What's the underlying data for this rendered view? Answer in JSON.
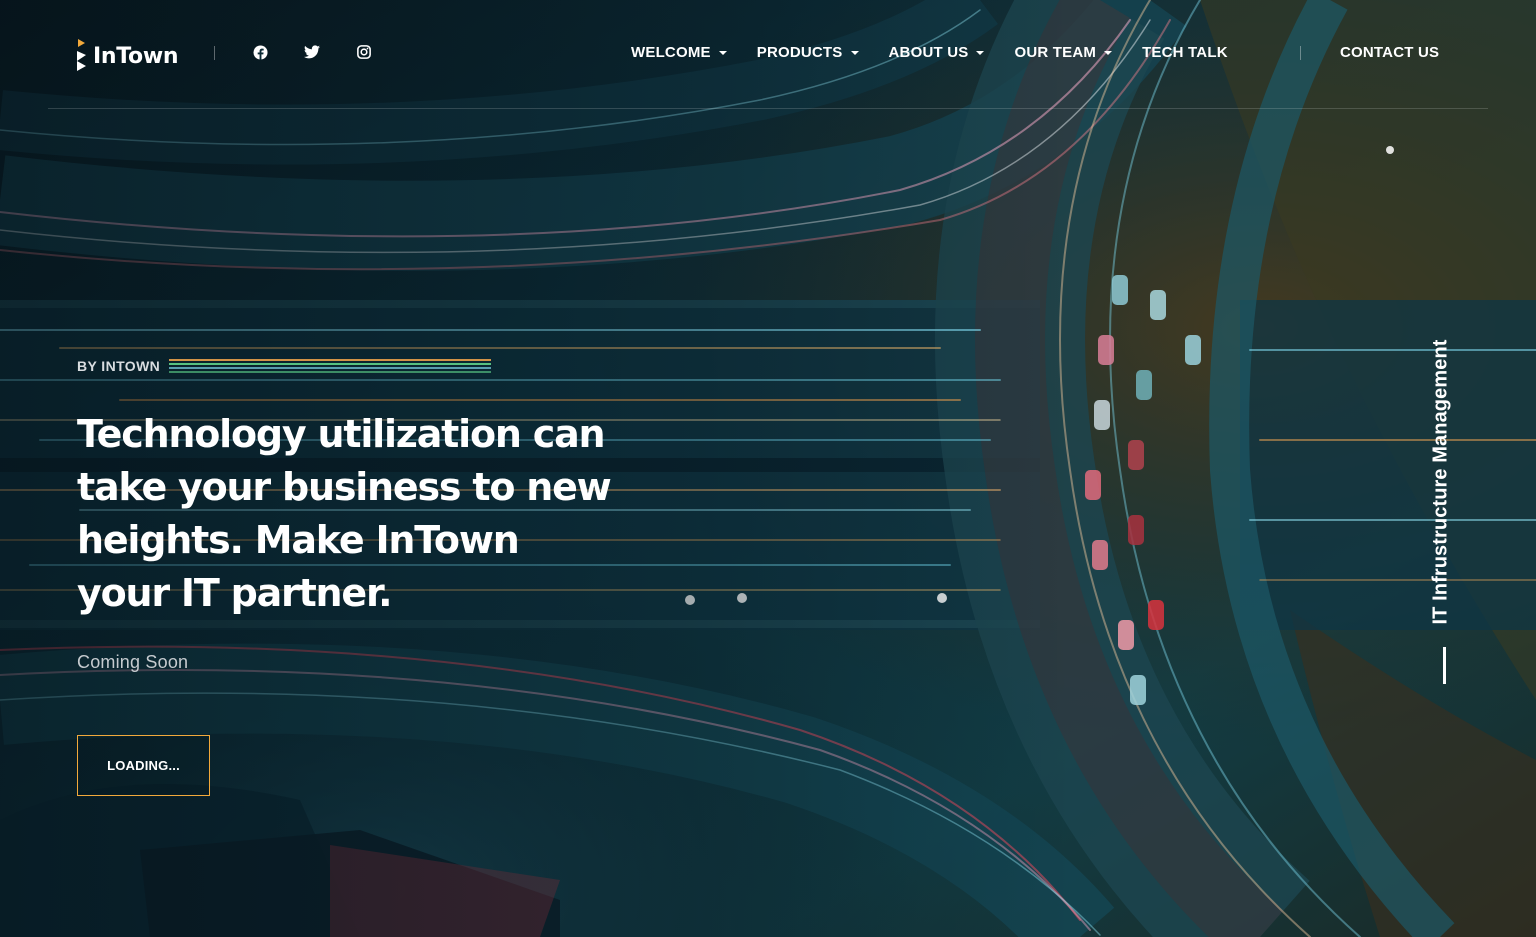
{
  "header": {
    "logo_text": "InTown",
    "social": [
      {
        "name": "facebook",
        "icon": "facebook-icon"
      },
      {
        "name": "twitter",
        "icon": "twitter-icon"
      },
      {
        "name": "instagram",
        "icon": "instagram-icon"
      }
    ],
    "nav": [
      {
        "label": "WELCOME",
        "dropdown": true
      },
      {
        "label": "PRODUCTS",
        "dropdown": true
      },
      {
        "label": "ABOUT US",
        "dropdown": true
      },
      {
        "label": "OUR TEAM",
        "dropdown": true
      },
      {
        "label": "TECH TALK",
        "dropdown": false
      }
    ],
    "contact_label": "CONTACT US"
  },
  "hero": {
    "byline": "BY INTOWN",
    "headline": "Technology utilization can take your business to new heights. Make InTown your IT partner.",
    "subtext": "Coming Soon",
    "button_label": "LOADING..."
  },
  "side_label": "IT Infrustructure Management",
  "colors": {
    "accent_orange": "#f2a93b",
    "byline_line_green": "#5fd38a",
    "byline_line_orange": "#e8a04a",
    "background_teal": "#0e3b48",
    "text_white": "#ffffff"
  }
}
